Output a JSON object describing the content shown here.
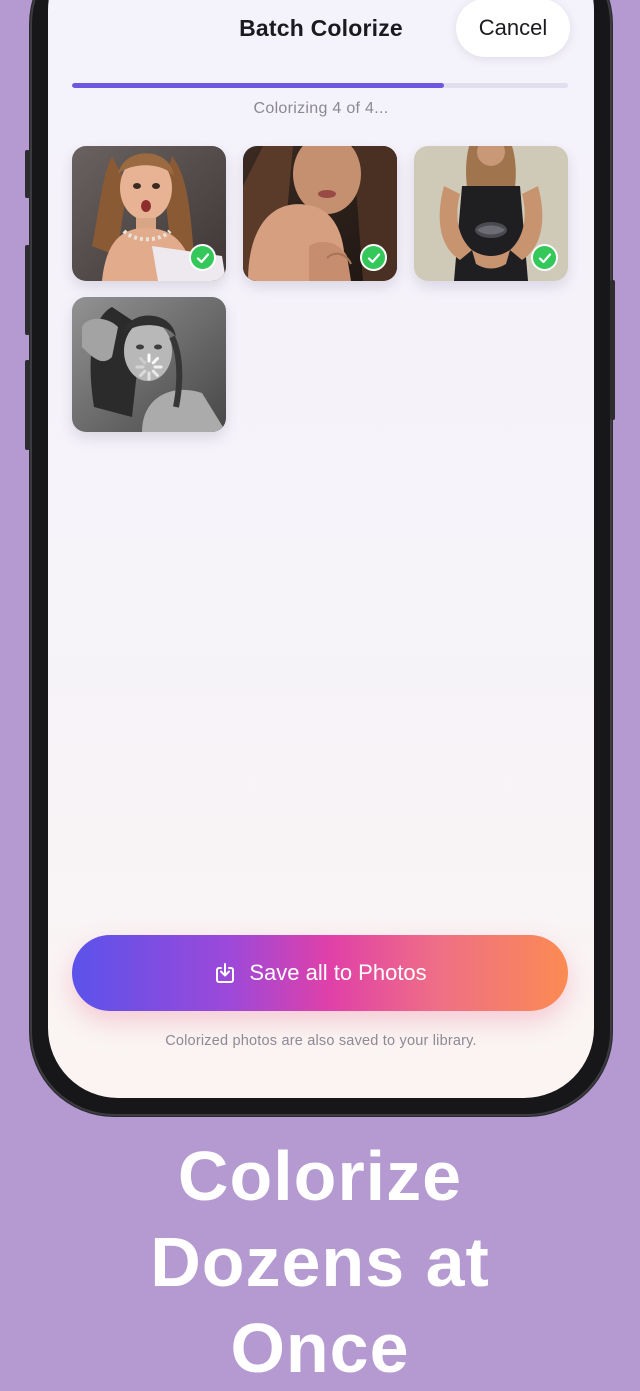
{
  "header": {
    "title": "Batch Colorize",
    "cancel_label": "Cancel"
  },
  "progress": {
    "label": "Colorizing 4 of 4...",
    "fraction": 0.75,
    "color": "#6e57e0"
  },
  "photos": [
    {
      "status": "done",
      "badge_icon": "checkmark-icon",
      "tone": "color"
    },
    {
      "status": "done",
      "badge_icon": "checkmark-icon",
      "tone": "color"
    },
    {
      "status": "done",
      "badge_icon": "checkmark-icon",
      "tone": "color"
    },
    {
      "status": "processing",
      "badge_icon": "spinner-icon",
      "tone": "grayscale"
    }
  ],
  "save": {
    "label": "Save all to Photos",
    "icon": "save-to-photos-icon",
    "gradient": [
      "#5b52ea",
      "#e040a8",
      "#fb8b52"
    ]
  },
  "footer_note": "Colorized photos are also saved to your library.",
  "caption": {
    "lines": [
      "Colorize",
      "Dozens at",
      "Once"
    ],
    "color": "#ffffff"
  },
  "colors": {
    "background": "#b49ad1",
    "success": "#34c759"
  }
}
